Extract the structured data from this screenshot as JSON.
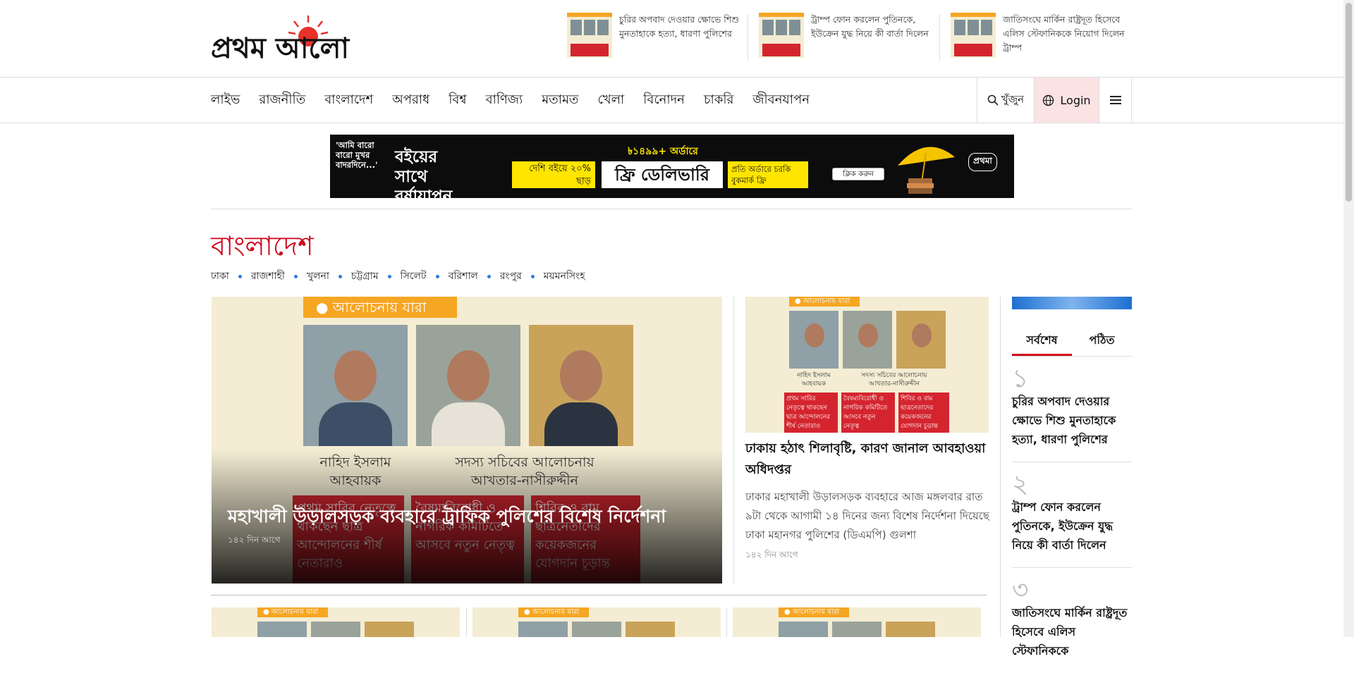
{
  "site": {
    "logo_text": "প্রথম আলো"
  },
  "trending": [
    {
      "title": "চুরির অপবাদ দেওয়ার ক্ষোভে শিশু মুনতাহাকে হত্যা, ধারণা পুলিশের"
    },
    {
      "title": "ট্রাম্প ফোন করলেন পুতিনকে, ইউক্রেন যুদ্ধ নিয়ে কী বার্তা দিলেন"
    },
    {
      "title": "জাতিসংঘে মার্কিন রাষ্ট্রদূত হিসেবে এলিস স্টেফানিককে নিয়োগ দিলেন ট্রাম্প"
    }
  ],
  "nav": {
    "items": [
      "লাইভ",
      "রাজনীতি",
      "বাংলাদেশ",
      "অপরাধ",
      "বিশ্ব",
      "বাণিজ্য",
      "মতামত",
      "খেলা",
      "বিনোদন",
      "চাকরি",
      "জীবনযাপন"
    ],
    "search_label": "খুঁজুন",
    "login_label": "Login",
    "icons": {
      "search": "search-icon",
      "globe": "globe-icon",
      "menu": "hamburger-menu-icon"
    }
  },
  "banner": {
    "quote": "'আমি বারো বারো মুখর বাদরদিনে...'",
    "headline": "বইয়ের সাথে বর্ষাযাপন",
    "discount": "দেশি বইয়ে ২০% ছাড়",
    "order_text": "৳১৪৯৯+ অর্ডারে",
    "delivery": "ফ্রি ডেলিভারি",
    "bookmark": "প্রতি অর্ডারে চরকি বুকমার্ক ফ্রি",
    "cta": "ক্লিক করুন",
    "brand": "প্রথমা"
  },
  "section": {
    "title": "বাংলাদেশ",
    "divisions": [
      "ঢাকা",
      "রাজশাহী",
      "খুলনা",
      "চট্টগ্রাম",
      "সিলেট",
      "বরিশাল",
      "রংপুর",
      "ময়মনসিংহ"
    ]
  },
  "image_text": {
    "tag": "● আলোচনায় যারা",
    "name1": "নাহিদ ইসলাম",
    "role1": "আহবায়ক",
    "name2": "সদস্য সচিবের আলোচনায়",
    "role2": "আখতার-নাসীরুদ্দীন",
    "box1": "প্রথম সারির নেতৃত্বে থাকছেন ছাত্র আন্দোলনের শীর্ষ নেতারাও",
    "box2": "বৈষম্যবিরোধী ও নাগরিক কমিটিতে আসবে নতুন নেতৃত্ব",
    "box3": "শিবির ও বাম ছাত্রনেতাদের কয়েকজনের যোগদান চূড়ান্ত"
  },
  "lead": {
    "headline": "মহাখালী উড়ালসড়ক ব্যবহারে ট্রাফিক পুলিশের বিশেষ নির্দেশনা",
    "time": "১৪২ দিন আগে"
  },
  "second": {
    "headline": "ঢাকায় হঠাৎ শিলাবৃষ্টি, কারণ জানাল আবহাওয়া অধিদপ্তর",
    "summary": "ঢাকার মহাখালী উড়ালসড়ক ব্যবহারে আজ মঙ্গলবার রাত ৯টা থেকে আগামী ১৪ দিনের জন্য বিশেষ নির্দেশনা দিয়েছে ঢাকা মহানগর পুলিশের (ডিএমপি) গুলশা",
    "time": "১৪২ দিন আগে"
  },
  "sidebar": {
    "tabs": [
      "সর্বশেষ",
      "পঠিত"
    ],
    "ranked": [
      {
        "num": "১",
        "title": "চুরির অপবাদ দেওয়ার ক্ষোভে শিশু মুনতাহাকে হত্যা, ধারণা পুলিশের"
      },
      {
        "num": "২",
        "title": "ট্রাম্প ফোন করলেন পুতিনকে, ইউক্রেন যুদ্ধ নিয়ে কী বার্তা দিলেন"
      },
      {
        "num": "৩",
        "title": "জাতিসংঘে মার্কিন রাষ্ট্রদূত হিসেবে এলিস স্টেফানিককে"
      }
    ]
  },
  "colors": {
    "brand_red": "#d0021b",
    "accent_blue": "#2f7bdc",
    "tag_orange": "#f5a623"
  }
}
